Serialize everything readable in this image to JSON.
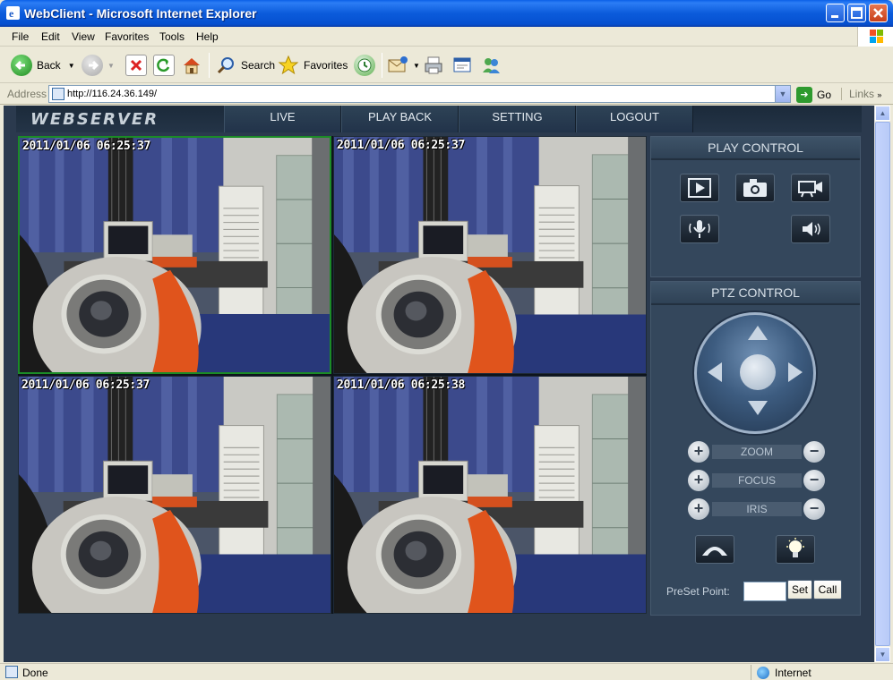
{
  "window": {
    "title": "WebClient - Microsoft Internet Explorer",
    "minimize": "_",
    "maximize": "□",
    "close": "✕"
  },
  "menu": [
    "File",
    "Edit",
    "View",
    "Favorites",
    "Tools",
    "Help"
  ],
  "toolbar": {
    "back": "Back",
    "search": "Search",
    "favorites": "Favorites"
  },
  "address": {
    "label": "Address",
    "url": "http://116.24.36.149/",
    "go": "Go",
    "links": "Links"
  },
  "app": {
    "logo": "WEBSERVER",
    "nav": [
      "LIVE",
      "PLAY BACK",
      "SETTING",
      "LOGOUT"
    ],
    "cameras": [
      {
        "timestamp": "2011/01/06 06:25:37",
        "active": true
      },
      {
        "timestamp": "2011/01/06 06:25:37",
        "active": false
      },
      {
        "timestamp": "2011/01/06 06:25:37",
        "active": false
      },
      {
        "timestamp": "2011/01/06 06:25:38",
        "active": false
      }
    ],
    "play_control": {
      "title": "PLAY CONTROL"
    },
    "ptz_control": {
      "title": "PTZ CONTROL",
      "zoom": "ZOOM",
      "focus": "FOCUS",
      "iris": "IRIS",
      "preset_label": "PreSet Point:",
      "preset_value": "",
      "set": "Set",
      "call": "Call"
    }
  },
  "status": {
    "text": "Done",
    "zone": "Internet"
  },
  "colors": {
    "titlebar": "#0A5FE7",
    "content_bg": "#2B3A4E",
    "active_cam_border": "#1B8B26"
  }
}
